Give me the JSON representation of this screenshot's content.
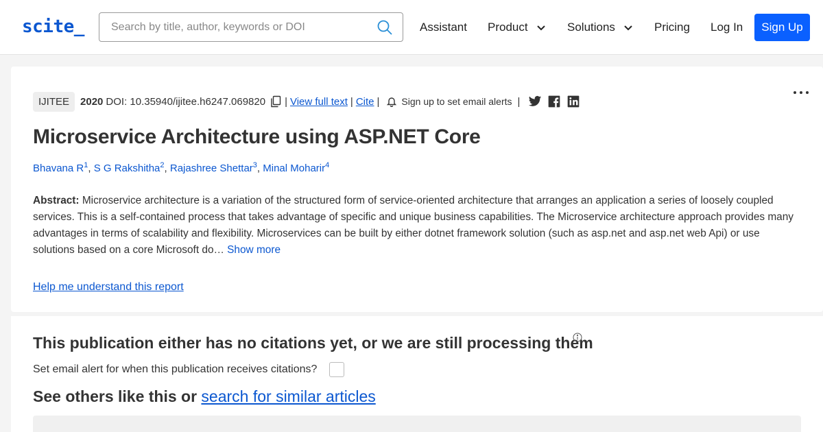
{
  "header": {
    "logo": "scite_",
    "search_placeholder": "Search by title, author, keywords or DOI",
    "nav": {
      "assistant": "Assistant",
      "product": "Product",
      "solutions": "Solutions",
      "pricing": "Pricing",
      "login": "Log In",
      "signup": "Sign Up"
    }
  },
  "paper": {
    "journal": "IJITEE",
    "year": "2020",
    "doi": "DOI: 10.35940/ijitee.h6247.069820",
    "view_full_text": "View full text",
    "cite": "Cite",
    "email_alerts": "Sign up to set email alerts",
    "title": "Microservice Architecture using ASP.NET Core",
    "authors": [
      {
        "name": "Bhavana R",
        "sup": "1"
      },
      {
        "name": "S G Rakshitha",
        "sup": "2"
      },
      {
        "name": "Rajashree Shettar",
        "sup": "3"
      },
      {
        "name": "Minal Moharir",
        "sup": "4"
      }
    ],
    "abstract_label": "Abstract:",
    "abstract_text": "Microservice architecture is a variation of the structured form of service-oriented architecture that arranges an application a series of loosely coupled services. This is a self-contained process that takes advantage of specific and unique business capabilities. The Microservice architecture approach provides many advantages in terms of scalability and flexibility. Microservices can be built by either dotnet framework solution (such as asp.net and asp.net web Api) or use solutions based on a core Microsoft do…",
    "show_more": "Show more",
    "help_link": "Help me understand this report"
  },
  "citations": {
    "title": "This publication either has no citations yet, or we are still processing them",
    "email_prompt": "Set email alert for when this publication receives citations?",
    "others_prefix": "See others like this or ",
    "others_link": "search for similar articles"
  },
  "colors": {
    "accent": "#0b57d0",
    "signup_bg": "#0a60ff"
  }
}
